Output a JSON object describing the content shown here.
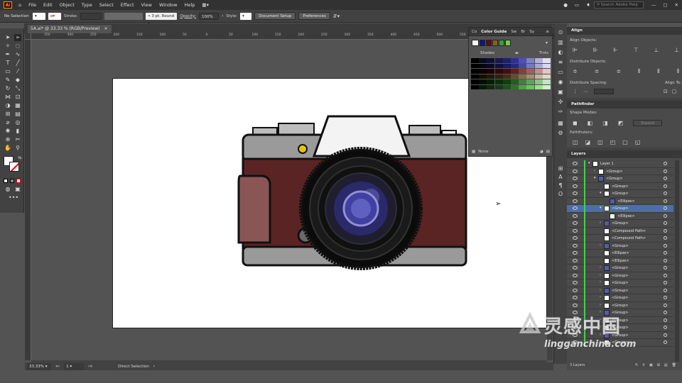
{
  "menu": [
    "File",
    "Edit",
    "Object",
    "Type",
    "Select",
    "Effect",
    "View",
    "Window",
    "Help"
  ],
  "app": {
    "logo": "Ai",
    "search_placeholder": "Search Adobe Help"
  },
  "control": {
    "selection": "No Selection",
    "stroke_label": "Stroke:",
    "brush": "3 pt. Round",
    "opacity_label": "Opacity:",
    "opacity_value": "100%",
    "style_label": "Style:",
    "document_setup": "Document Setup",
    "preferences": "Preferences"
  },
  "document": {
    "tab_title": "5A.ai* @ 33.33 % (RGB/Preview)",
    "close": "×"
  },
  "ruler_labels": [
    "350",
    "300",
    "250",
    "200",
    "150",
    "100",
    "50",
    "0",
    "50",
    "100",
    "150",
    "200",
    "250",
    "300",
    "350",
    "400",
    "450",
    "500",
    "550",
    "600",
    "650",
    "700"
  ],
  "status": {
    "zoom": "33.33%",
    "artboard": "1",
    "tool": "Direct Selection"
  },
  "color_guide": {
    "tabs": [
      "Co",
      "Color Guide",
      "Sw",
      "Br",
      "Sy"
    ],
    "shades": "Shades",
    "tints": "Tints",
    "footer": "None",
    "colors": {
      "row_top": [
        "#0a1a7a",
        "#5a1010",
        "#8a6020",
        "#3aa030",
        "#70d040"
      ],
      "grid": [
        [
          "#000000",
          "#0a0a20",
          "#10103a",
          "#181850",
          "#202070",
          "#303090",
          "#5050b0",
          "#8080c8",
          "#b0b0e0",
          "#e0e0f0"
        ],
        [
          "#000000",
          "#050510",
          "#0a0a28",
          "#101040",
          "#1a1a60",
          "#282880",
          "#4848a0",
          "#7878c0",
          "#a8a8d8",
          "#d8d8ee"
        ],
        [
          "#000000",
          "#100000",
          "#200000",
          "#300808",
          "#401010",
          "#602020",
          "#804040",
          "#a06060",
          "#c09090",
          "#e0c8c8"
        ],
        [
          "#000000",
          "#101000",
          "#201808",
          "#302010",
          "#403018",
          "#605030",
          "#807050",
          "#a09070",
          "#c0b8a0",
          "#e0d8c8"
        ],
        [
          "#000000",
          "#001000",
          "#002000",
          "#083008",
          "#104010",
          "#206020",
          "#408040",
          "#60a060",
          "#90c090",
          "#c8e0c8"
        ],
        [
          "#000000",
          "#081808",
          "#102810",
          "#183818",
          "#205020",
          "#307030",
          "#50a040",
          "#70c060",
          "#a0e090",
          "#d0f0c8"
        ]
      ]
    }
  },
  "align": {
    "title": "Align",
    "align_objects": "Align Objects:",
    "distribute_objects": "Distribute Objects:",
    "distribute_spacing": "Distribute Spacing:",
    "align_to": "Align To:"
  },
  "pathfinder": {
    "title": "Pathfinder",
    "shape_modes": "Shape Modes:",
    "expand": "Expand",
    "pathfinders": "Pathfinders:"
  },
  "layers": {
    "title": "Layers",
    "count": "3 Layers",
    "rows": [
      {
        "name": "Layer 1",
        "indent": 0,
        "chev": "v"
      },
      {
        "name": "<Group>",
        "indent": 1,
        "chev": ">"
      },
      {
        "name": "<Group>",
        "indent": 1,
        "chev": "v"
      },
      {
        "name": "<Group>",
        "indent": 2,
        "chev": ""
      },
      {
        "name": "<Group>",
        "indent": 2,
        "chev": "v"
      },
      {
        "name": "<Ellipse>",
        "indent": 3,
        "chev": ""
      },
      {
        "name": "<Group>",
        "indent": 2,
        "chev": "v"
      },
      {
        "name": "<Ellipse>",
        "indent": 3,
        "chev": ""
      },
      {
        "name": "<Group>",
        "indent": 2,
        "chev": ">"
      },
      {
        "name": "<Compound Path>",
        "indent": 2,
        "chev": ""
      },
      {
        "name": "<Compound Path>",
        "indent": 2,
        "chev": ""
      },
      {
        "name": "<Group>",
        "indent": 2,
        "chev": ">"
      },
      {
        "name": "<Ellipse>",
        "indent": 2,
        "chev": ""
      },
      {
        "name": "<Ellipse>",
        "indent": 2,
        "chev": ""
      },
      {
        "name": "<Group>",
        "indent": 2,
        "chev": ">"
      },
      {
        "name": "<Group>",
        "indent": 2,
        "chev": ">"
      },
      {
        "name": "<Group>",
        "indent": 2,
        "chev": ">"
      },
      {
        "name": "<Group>",
        "indent": 2,
        "chev": ">"
      },
      {
        "name": "<Group>",
        "indent": 2,
        "chev": ">"
      },
      {
        "name": "<Group>",
        "indent": 2,
        "chev": ">"
      },
      {
        "name": "<Group>",
        "indent": 2,
        "chev": ">"
      },
      {
        "name": "<Group>",
        "indent": 2,
        "chev": ">"
      },
      {
        "name": "<Group>",
        "indent": 2,
        "chev": ">"
      },
      {
        "name": "<Group>",
        "indent": 2,
        "chev": ">"
      },
      {
        "name": "<Group>",
        "indent": 2,
        "chev": ">"
      }
    ]
  },
  "watermark": {
    "brand": "灵感中国",
    "url": "lingganchina.com"
  },
  "accent": {
    "layer_bar": "#3fd24f",
    "selected_row": "#4f6ea8",
    "artboard": "#ffffff"
  },
  "illustration": {
    "colors": {
      "body_top": "#9a9a9a",
      "body_leather": "#5a2424",
      "grip": "#8a5555",
      "lens_outer": "#101010",
      "lens_glass": "#2a2a6a",
      "lens_center": "#4040a0",
      "flash": "#ffffff",
      "knurl": "#bdbdbd",
      "yellow": "#e8c400"
    }
  }
}
